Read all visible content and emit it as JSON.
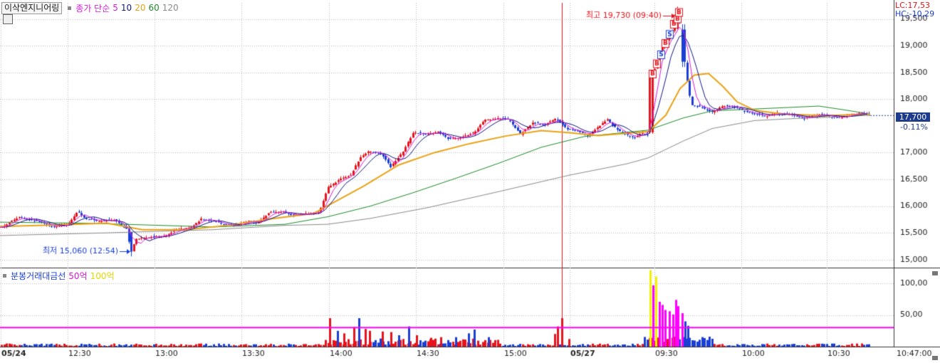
{
  "header": {
    "stock_name": "이삭엔지니어링",
    "ma_title": "종가 단순",
    "ma_periods": [
      "5",
      "10",
      "20",
      "60",
      "120"
    ],
    "lc_text": "LC:17,53",
    "hc_text": "HC:-10,29"
  },
  "volume_header": {
    "title": "분봉거래대금선",
    "level1": "50억",
    "level2": "100억"
  },
  "current": {
    "price_label": "17,700",
    "change_label": "-0.11%"
  },
  "annotations": {
    "high": "최고 19,730 (09:40)",
    "low": "최저 15,060 (12:54)"
  },
  "colors": {
    "up": "#e8121b",
    "down": "#1a3fd6",
    "ma5": "#d81ad8",
    "ma10": "#12187e",
    "ma20": "#e8a317",
    "ma60": "#1f8a2a",
    "ma120": "#8a8a8a",
    "threshold": "#ff00ff",
    "surge": "#ff00ff",
    "surge_peak": "#f2f200",
    "divider": "#e8121b"
  },
  "chart_data": [
    {
      "type": "candlestick",
      "y_ticks": [
        "19,500",
        "19,000",
        "18,500",
        "18,000",
        "17,700",
        "17,000",
        "16,500",
        "16,000",
        "15,500",
        "15,000"
      ],
      "y_tick_values": [
        19500,
        19000,
        18500,
        18000,
        17700,
        17000,
        16500,
        16000,
        15500,
        15000
      ],
      "ylim": [
        14850,
        19800
      ],
      "x_ticks": [
        "05/24",
        "12:30",
        "13:00",
        "13:30",
        "14:00",
        "14:30",
        "15:00",
        "05/27",
        "09:30",
        "10:00",
        "10:30",
        "10:47:00"
      ],
      "price_path": [
        [
          0,
          15600
        ],
        [
          12,
          15690
        ],
        [
          25,
          15790
        ],
        [
          45,
          15740
        ],
        [
          60,
          15680
        ],
        [
          75,
          15610
        ],
        [
          95,
          15660
        ],
        [
          108,
          15900
        ],
        [
          118,
          15780
        ],
        [
          135,
          15720
        ],
        [
          160,
          15740
        ],
        [
          178,
          15560
        ],
        [
          183,
          15100
        ],
        [
          190,
          15380
        ],
        [
          210,
          15420
        ],
        [
          232,
          15450
        ],
        [
          248,
          15560
        ],
        [
          268,
          15610
        ],
        [
          282,
          15760
        ],
        [
          300,
          15720
        ],
        [
          318,
          15640
        ],
        [
          332,
          15640
        ],
        [
          348,
          15720
        ],
        [
          362,
          15690
        ],
        [
          378,
          15880
        ],
        [
          398,
          15900
        ],
        [
          410,
          15820
        ],
        [
          428,
          15860
        ],
        [
          448,
          15880
        ],
        [
          460,
          16350
        ],
        [
          478,
          16510
        ],
        [
          492,
          16580
        ],
        [
          505,
          16900
        ],
        [
          518,
          17030
        ],
        [
          535,
          16980
        ],
        [
          548,
          16730
        ],
        [
          565,
          17010
        ],
        [
          580,
          17380
        ],
        [
          598,
          17340
        ],
        [
          615,
          17390
        ],
        [
          630,
          17250
        ],
        [
          645,
          17280
        ],
        [
          665,
          17370
        ],
        [
          680,
          17610
        ],
        [
          700,
          17640
        ],
        [
          715,
          17610
        ],
        [
          730,
          17350
        ],
        [
          748,
          17560
        ],
        [
          765,
          17520
        ],
        [
          780,
          17640
        ],
        [
          795,
          17440
        ],
        [
          810,
          17410
        ],
        [
          825,
          17320
        ],
        [
          840,
          17480
        ],
        [
          852,
          17620
        ],
        [
          862,
          17480
        ],
        [
          875,
          17350
        ],
        [
          890,
          17280
        ],
        [
          900,
          17360
        ],
        [
          910,
          17340
        ],
        [
          915,
          18450
        ],
        [
          922,
          18650
        ],
        [
          930,
          19000
        ],
        [
          940,
          19200
        ],
        [
          948,
          19350
        ],
        [
          952,
          19650
        ],
        [
          958,
          19000
        ],
        [
          963,
          18450
        ],
        [
          970,
          17900
        ],
        [
          985,
          17850
        ],
        [
          1000,
          17750
        ],
        [
          1015,
          17880
        ],
        [
          1030,
          17860
        ],
        [
          1045,
          17770
        ],
        [
          1060,
          17720
        ],
        [
          1075,
          17680
        ],
        [
          1090,
          17740
        ],
        [
          1110,
          17700
        ],
        [
          1130,
          17640
        ],
        [
          1150,
          17720
        ],
        [
          1165,
          17680
        ],
        [
          1180,
          17650
        ],
        [
          1195,
          17720
        ],
        [
          1210,
          17740
        ],
        [
          1222,
          17700
        ]
      ],
      "ma20_path": [
        [
          0,
          15620
        ],
        [
          80,
          15650
        ],
        [
          150,
          15680
        ],
        [
          200,
          15560
        ],
        [
          260,
          15560
        ],
        [
          320,
          15640
        ],
        [
          380,
          15760
        ],
        [
          440,
          15860
        ],
        [
          470,
          16080
        ],
        [
          510,
          16370
        ],
        [
          560,
          16770
        ],
        [
          610,
          17000
        ],
        [
          660,
          17170
        ],
        [
          710,
          17310
        ],
        [
          760,
          17410
        ],
        [
          800,
          17370
        ],
        [
          840,
          17320
        ],
        [
          880,
          17360
        ],
        [
          910,
          17390
        ],
        [
          935,
          17700
        ],
        [
          955,
          18200
        ],
        [
          975,
          18450
        ],
        [
          995,
          18480
        ],
        [
          1015,
          18240
        ],
        [
          1035,
          17950
        ],
        [
          1060,
          17790
        ],
        [
          1100,
          17720
        ],
        [
          1160,
          17690
        ],
        [
          1222,
          17720
        ]
      ],
      "ma60_path": [
        [
          0,
          15700
        ],
        [
          120,
          15680
        ],
        [
          200,
          15650
        ],
        [
          300,
          15610
        ],
        [
          400,
          15660
        ],
        [
          460,
          15800
        ],
        [
          520,
          16000
        ],
        [
          580,
          16250
        ],
        [
          640,
          16520
        ],
        [
          700,
          16800
        ],
        [
          760,
          17100
        ],
        [
          820,
          17300
        ],
        [
          880,
          17380
        ],
        [
          910,
          17420
        ],
        [
          960,
          17650
        ],
        [
          1000,
          17780
        ],
        [
          1050,
          17810
        ],
        [
          1100,
          17840
        ],
        [
          1150,
          17870
        ],
        [
          1190,
          17790
        ],
        [
          1222,
          17720
        ]
      ],
      "ma120_path": [
        [
          0,
          15450
        ],
        [
          150,
          15500
        ],
        [
          300,
          15560
        ],
        [
          400,
          15640
        ],
        [
          460,
          15660
        ],
        [
          520,
          15770
        ],
        [
          600,
          15970
        ],
        [
          700,
          16270
        ],
        [
          800,
          16580
        ],
        [
          880,
          16790
        ],
        [
          910,
          16900
        ],
        [
          960,
          17220
        ],
        [
          1000,
          17450
        ],
        [
          1060,
          17600
        ],
        [
          1120,
          17640
        ],
        [
          1180,
          17670
        ],
        [
          1222,
          17700
        ]
      ],
      "signals": [
        {
          "x": 916,
          "price": 18470,
          "label": "B"
        },
        {
          "x": 922,
          "price": 18660,
          "label": "B"
        },
        {
          "x": 928,
          "price": 18830,
          "label": "S"
        },
        {
          "x": 934,
          "price": 19040,
          "label": "B"
        },
        {
          "x": 940,
          "price": 19210,
          "label": "S"
        },
        {
          "x": 946,
          "price": 19400,
          "label": "B"
        },
        {
          "x": 951,
          "price": 19500,
          "label": "B"
        },
        {
          "x": 953,
          "price": 19620,
          "label": "B"
        }
      ]
    },
    {
      "type": "bar",
      "name": "분봉거래대금선",
      "y_ticks": [
        "100,00",
        "50,00"
      ],
      "y_tick_values": [
        100,
        50
      ],
      "ylim": [
        0,
        125
      ],
      "threshold": 30,
      "volume_spikes": [
        [
          463,
          45
        ],
        [
          474,
          25
        ],
        [
          483,
          21
        ],
        [
          497,
          31
        ],
        [
          504,
          45
        ],
        [
          513,
          28
        ],
        [
          519,
          25
        ],
        [
          537,
          24
        ],
        [
          549,
          23
        ],
        [
          560,
          18
        ],
        [
          574,
          32
        ],
        [
          585,
          18
        ],
        [
          605,
          14
        ],
        [
          619,
          15
        ],
        [
          640,
          15
        ],
        [
          658,
          21
        ],
        [
          666,
          27
        ],
        [
          686,
          15
        ],
        [
          779,
          20
        ],
        [
          783,
          32
        ],
        [
          789,
          45
        ],
        [
          799,
          12
        ],
        [
          913,
          121
        ],
        [
          917,
          97
        ],
        [
          921,
          111
        ],
        [
          926,
          71
        ],
        [
          930,
          66
        ],
        [
          934,
          58
        ],
        [
          940,
          56
        ],
        [
          945,
          51
        ],
        [
          949,
          74
        ],
        [
          952,
          64
        ],
        [
          958,
          53
        ],
        [
          962,
          40
        ],
        [
          966,
          33
        ]
      ],
      "divider_x": 789
    }
  ]
}
